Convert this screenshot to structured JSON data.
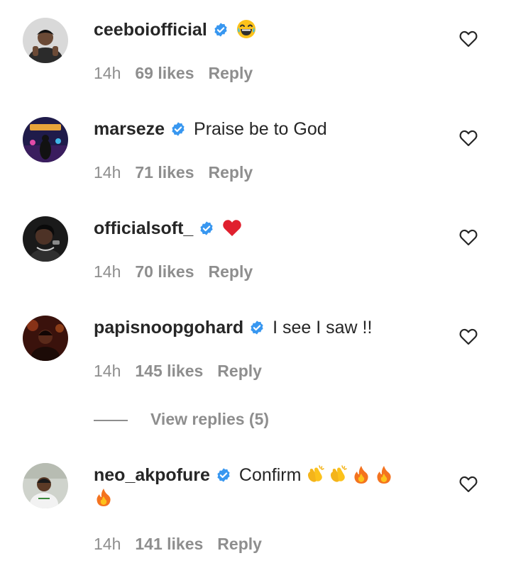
{
  "comments": [
    {
      "username": "ceeboiofficial",
      "text": "",
      "emojis": [
        "laughing-tears-emoji"
      ],
      "time": "14h",
      "likes": "69 likes",
      "reply": "Reply"
    },
    {
      "username": "marseze",
      "text": "Praise be to God",
      "emojis": [],
      "time": "14h",
      "likes": "71 likes",
      "reply": "Reply"
    },
    {
      "username": "officialsoft_",
      "text": "",
      "emojis": [
        "red-heart-emoji"
      ],
      "time": "14h",
      "likes": "70 likes",
      "reply": "Reply"
    },
    {
      "username": "papisnoopgohard",
      "text": "I see I saw !!",
      "emojis": [],
      "time": "14h",
      "likes": "145 likes",
      "reply": "Reply",
      "view_replies": "View replies (5)"
    },
    {
      "username": "neo_akpofure",
      "text": "Confirm",
      "emojis": [
        "clapping-hands-emoji",
        "clapping-hands-emoji",
        "fire-emoji",
        "fire-emoji",
        "fire-emoji"
      ],
      "time": "14h",
      "likes": "141 likes",
      "reply": "Reply"
    }
  ],
  "colors": {
    "text": "#262626",
    "muted": "#8e8e8e",
    "verified": "#3897f0",
    "heart_outline": "#262626"
  },
  "icons": {
    "verified": "verified-badge-icon",
    "like": "heart-outline-icon"
  }
}
